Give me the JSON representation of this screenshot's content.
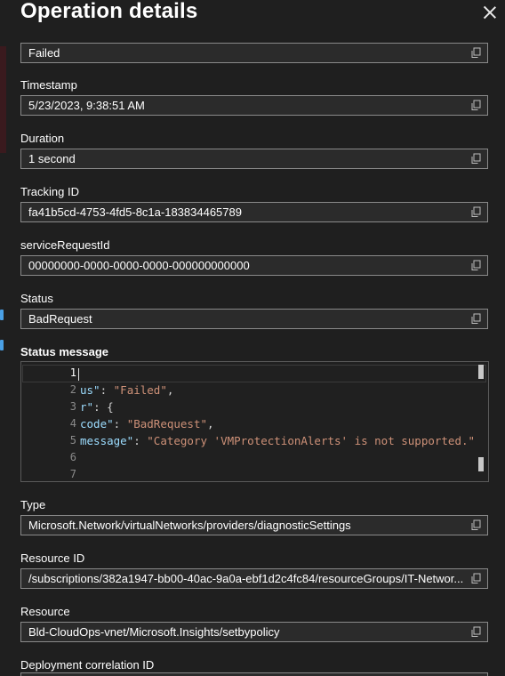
{
  "panel": {
    "title": "Operation details"
  },
  "fields": {
    "top_value": "Failed",
    "timestamp_label": "Timestamp",
    "timestamp_value": "5/23/2023, 9:38:51 AM",
    "duration_label": "Duration",
    "duration_value": "1 second",
    "tracking_label": "Tracking ID",
    "tracking_value": "fa41b5cd-4753-4fd5-8c1a-183834465789",
    "service_label": "serviceRequestId",
    "service_value": "00000000-0000-0000-0000-000000000000",
    "status_label": "Status",
    "status_value": "BadRequest",
    "status_message_label": "Status message",
    "type_label": "Type",
    "type_value": "Microsoft.Network/virtualNetworks/providers/diagnosticSettings",
    "resource_id_label": "Resource ID",
    "resource_id_value": "/subscriptions/382a1947-bb00-40ac-9a0a-ebf1d2c4fc84/resourceGroups/IT-Networ...",
    "resource_label": "Resource",
    "resource_value": "Bld-CloudOps-vnet/Microsoft.Insights/setbypolicy",
    "deployment_label": "Deployment correlation ID"
  },
  "editor": {
    "line_numbers": [
      "1",
      "2",
      "3",
      "4",
      "5",
      "6",
      "7"
    ],
    "line2_key": "us\"",
    "line2_sep": ": ",
    "line2_val": "\"Failed\"",
    "line2_end": ",",
    "line3_key": "r\"",
    "line3_sep": ": {",
    "line4_key": "code\"",
    "line4_sep": ": ",
    "line4_val": "\"BadRequest\"",
    "line4_end": ",",
    "line5_key": "message\"",
    "line5_sep": ": ",
    "line5_val": "\"Category 'VMProtectionAlerts' is not supported.\""
  },
  "icons": {
    "copy": "copy-icon",
    "close": "close-icon"
  },
  "colors": {
    "background": "#1f1f1f",
    "field_bg": "#2b2b2b",
    "json_key": "#9cdcfe",
    "json_string": "#ce9178"
  }
}
